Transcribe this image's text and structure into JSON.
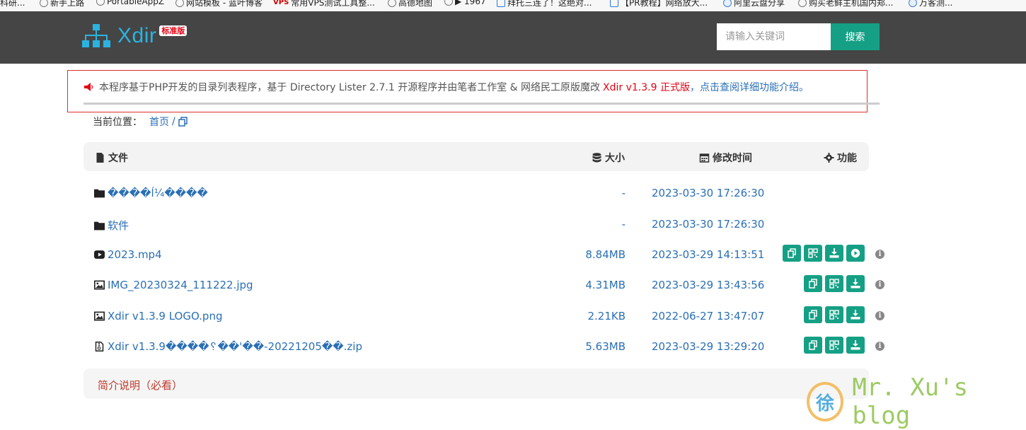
{
  "bookmarks": [
    {
      "label": "科研..."
    },
    {
      "label": "新手上路"
    },
    {
      "label": "PortableAppZ"
    },
    {
      "label": "网站模板 - 蓝叶博客"
    },
    {
      "label": "常用VPS测试工具整..."
    },
    {
      "label": "高德地图"
    },
    {
      "label": "▶ 1967"
    },
    {
      "label": "拜托三连了！这绝对..."
    },
    {
      "label": "【PR教程】网络放大..."
    },
    {
      "label": "阿里云盘分享"
    },
    {
      "label": "购买老鲜主机国内郑..."
    },
    {
      "label": "万客测..."
    }
  ],
  "header": {
    "brand": "Xdir",
    "edition": "标准版",
    "search_placeholder": "请输入关键词",
    "search_button": "搜索"
  },
  "notice": {
    "text": "本程序基于PHP开发的目录列表程序，基于 Directory Lister 2.7.1 开源程序并由笔者工作室 & 网络民工原版魔改",
    "version": "Xdir v1.3.9 正式版",
    "link": "，点击查阅详细功能介绍。"
  },
  "breadcrumb": {
    "label": "当前位置：",
    "home": "首页",
    "separator": "/"
  },
  "table": {
    "col_file": "文件",
    "col_size": "大小",
    "col_time": "修改时间",
    "col_actions": "功能"
  },
  "files": [
    {
      "type": "folder",
      "name": "����ĺ¼����",
      "size": "-",
      "time": "2023-03-30 17:26:30"
    },
    {
      "type": "folder",
      "name": "软件",
      "size": "-",
      "time": "2023-03-30 17:26:30"
    },
    {
      "type": "video",
      "name": "2023.mp4",
      "size": "8.84MB",
      "time": "2023-03-29 14:13:51"
    },
    {
      "type": "image",
      "name": "IMG_20230324_111222.jpg",
      "size": "4.31MB",
      "time": "2023-03-29 13:43:56"
    },
    {
      "type": "image",
      "name": "Xdir v1.3.9 LOGO.png",
      "size": "2.21KB",
      "time": "2022-06-27 13:47:07"
    },
    {
      "type": "archive",
      "name": "Xdir v1.3.9����␦��'��-20221205��.zip",
      "size": "5.63MB",
      "time": "2023-03-29 13:29:20"
    }
  ],
  "readme": "简介说明（必看）",
  "watermark": {
    "glyph": "徐",
    "text": "Mr. Xu's blog"
  },
  "colors": {
    "header_bg": "#454545",
    "accent": "#15a085",
    "link": "#2a6fb5",
    "brand": "#2bb3e0",
    "notice_border": "#d9302c"
  }
}
